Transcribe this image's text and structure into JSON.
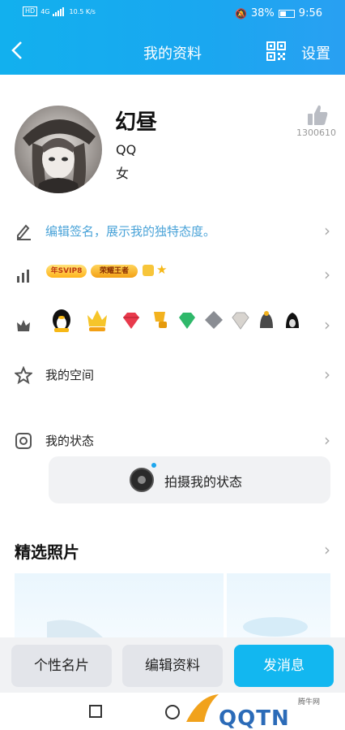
{
  "status_bar": {
    "sim": "HD",
    "network": "4G",
    "speed": "10.5 K/s",
    "battery": "38%",
    "time": "9:56"
  },
  "nav": {
    "title": "我的资料",
    "settings_label": "设置"
  },
  "profile": {
    "name": "幻昼",
    "qq_label": "QQ",
    "gender": "女",
    "like_count": "1300610"
  },
  "rows": {
    "signature": "编辑签名，展示我的独特态度。",
    "badges": {
      "svip": "年SVIP8",
      "king": "荣耀王者"
    },
    "space": "我的空间",
    "status": "我的状态"
  },
  "status_card": {
    "label": "拍摄我的状态"
  },
  "photos": {
    "title": "精选照片"
  },
  "buttons": {
    "card": "个性名片",
    "edit": "编辑资料",
    "message": "发消息"
  },
  "watermark": {
    "brand": "QQTN",
    "site_cn": "腾牛网"
  },
  "colors": {
    "accent": "#12b7f0",
    "signature": "#4aa3d8"
  }
}
